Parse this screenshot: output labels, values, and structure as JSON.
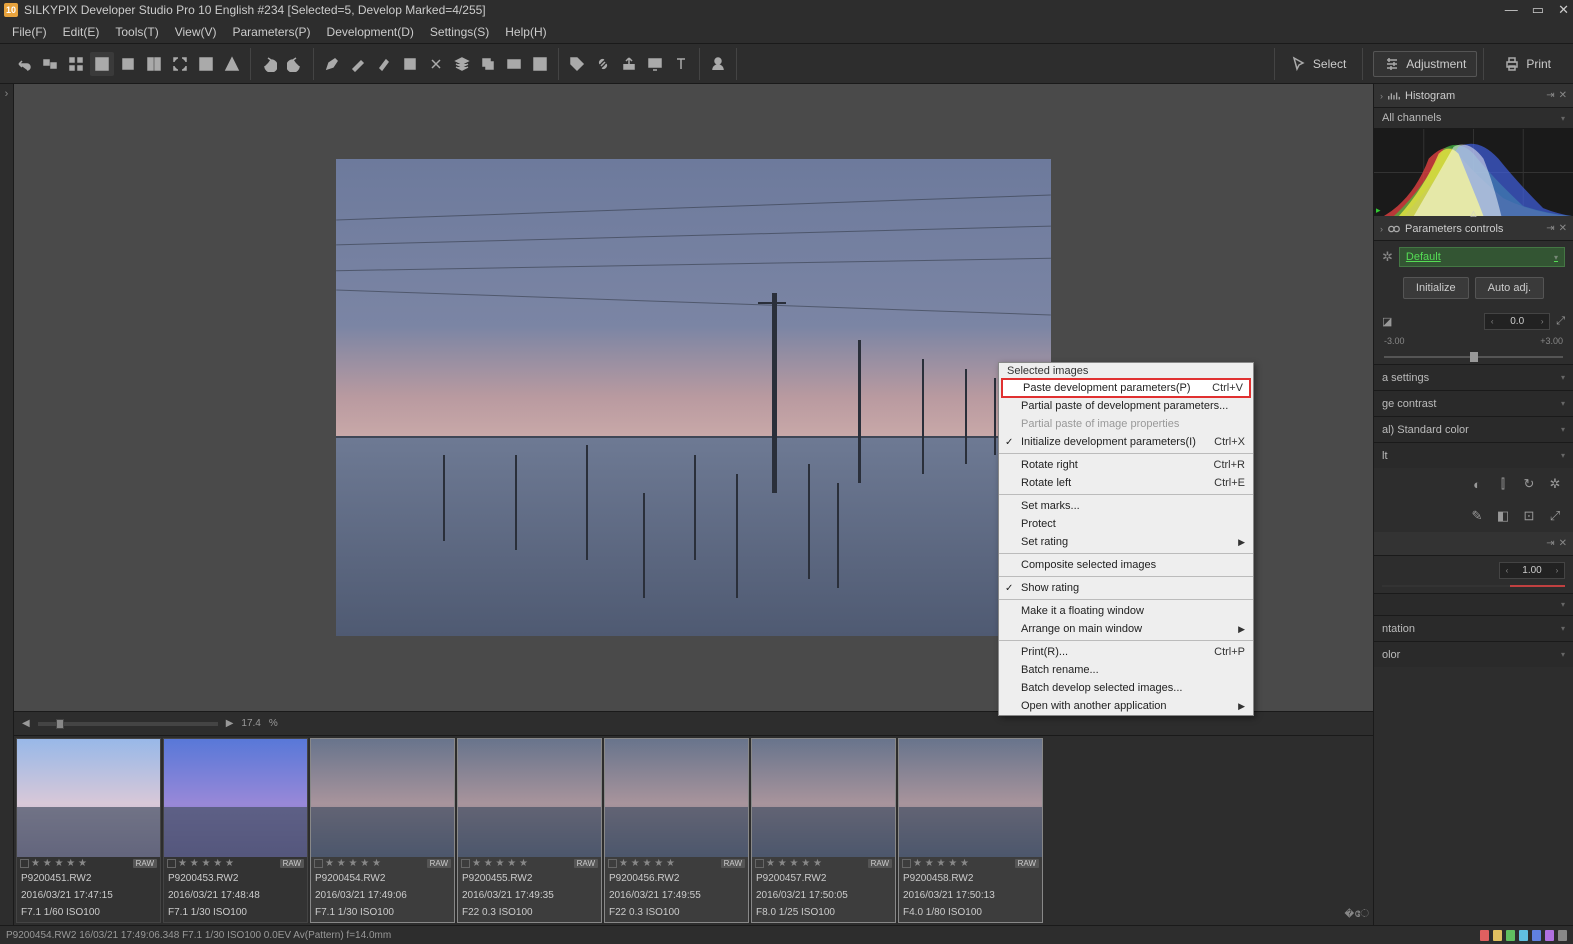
{
  "titlebar": {
    "app_icon_text": "10",
    "title": "SILKYPIX Developer Studio Pro 10 English   #234   [Selected=5, Develop Marked=4/255]"
  },
  "menubar": {
    "items": [
      "File(F)",
      "Edit(E)",
      "Tools(T)",
      "View(V)",
      "Parameters(P)",
      "Development(D)",
      "Settings(S)",
      "Help(H)"
    ]
  },
  "toolbar": {
    "select_label": "Select",
    "adjustment_label": "Adjustment",
    "print_label": "Print"
  },
  "zoom": {
    "value": "17.4",
    "unit": "%"
  },
  "thumbnails": [
    {
      "file": "P9200451.RW2",
      "date": "2016/03/21 17:47:15",
      "exp": "F7.1 1/60 ISO100",
      "style": "bright"
    },
    {
      "file": "P9200453.RW2",
      "date": "2016/03/21 17:48:48",
      "exp": "F7.1 1/30 ISO100",
      "style": "vivid"
    },
    {
      "file": "P9200454.RW2",
      "date": "2016/03/21 17:49:06",
      "exp": "F7.1 1/30 ISO100",
      "style": "dim",
      "selected": true
    },
    {
      "file": "P9200455.RW2",
      "date": "2016/03/21 17:49:35",
      "exp": "F22 0.3 ISO100",
      "style": "dim",
      "selected": true
    },
    {
      "file": "P9200456.RW2",
      "date": "2016/03/21 17:49:55",
      "exp": "F22 0.3 ISO100",
      "style": "dim",
      "selected": true
    },
    {
      "file": "P9200457.RW2",
      "date": "2016/03/21 17:50:05",
      "exp": "F8.0 1/25 ISO100",
      "style": "dim",
      "selected": true
    },
    {
      "file": "P9200458.RW2",
      "date": "2016/03/21 17:50:13",
      "exp": "F4.0 1/80 ISO100",
      "style": "dim",
      "selected": true
    }
  ],
  "raw_badge": "RAW",
  "right_panel": {
    "histogram_label": "Histogram",
    "channels_label": "All channels",
    "params_label": "Parameters controls",
    "preset": "Default",
    "init_btn": "Initialize",
    "auto_btn": "Auto adj.",
    "exposure_val": "0.0",
    "exposure_min": "-3.00",
    "exposure_max": "+3.00",
    "settings_rows": [
      "a settings",
      "ge contrast",
      "al) Standard color",
      "lt"
    ],
    "value_1_00": "1.00",
    "rows2": [
      "ntation",
      "olor"
    ]
  },
  "context_menu": {
    "title": "Selected images",
    "items": [
      {
        "label": "Paste development parameters(P)",
        "shortcut": "Ctrl+V",
        "highlighted": true
      },
      {
        "label": "Partial paste of development parameters..."
      },
      {
        "label": "Partial paste of image properties",
        "disabled": true
      },
      {
        "label": "Initialize development parameters(I)",
        "shortcut": "Ctrl+X",
        "checked": true
      },
      {
        "sep": true
      },
      {
        "label": "Rotate right",
        "shortcut": "Ctrl+R"
      },
      {
        "label": "Rotate left",
        "shortcut": "Ctrl+E"
      },
      {
        "sep": true
      },
      {
        "label": "Set marks..."
      },
      {
        "label": "Protect"
      },
      {
        "label": "Set rating",
        "submenu": true
      },
      {
        "sep": true
      },
      {
        "label": "Composite selected images"
      },
      {
        "sep": true
      },
      {
        "label": "Show rating",
        "checked": true
      },
      {
        "sep": true
      },
      {
        "label": "Make it a floating window"
      },
      {
        "label": "Arrange on main window",
        "submenu": true
      },
      {
        "sep": true
      },
      {
        "label": "Print(R)...",
        "shortcut": "Ctrl+P"
      },
      {
        "label": "Batch rename..."
      },
      {
        "label": "Batch develop selected images..."
      },
      {
        "label": "Open with another application",
        "submenu": true
      }
    ]
  },
  "statusbar": {
    "text": "P9200454.RW2 16/03/21 17:49:06.348 F7.1 1/30 ISO100  0.0EV Av(Pattern) f=14.0mm",
    "dot_colors": [
      "#e06060",
      "#e0c060",
      "#60c060",
      "#60c0e0",
      "#6080e0",
      "#b070e0",
      "#888"
    ]
  }
}
